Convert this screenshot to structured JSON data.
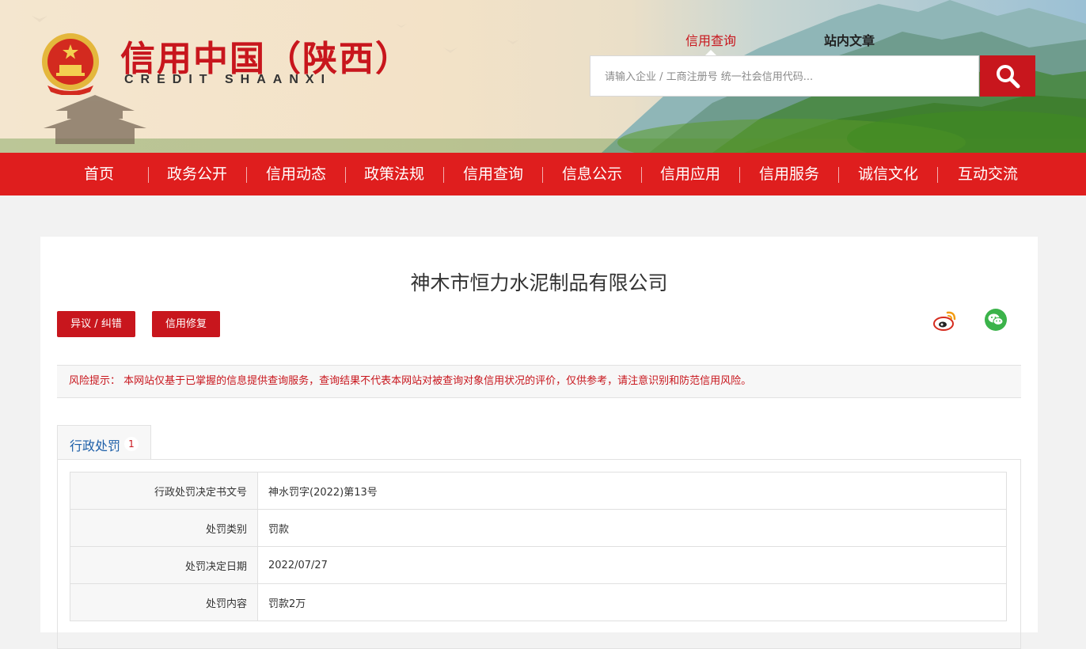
{
  "site": {
    "title": "信用中国（陕西）",
    "subtitle": "CREDIT  SHAANXI",
    "emblem_icon": "national-emblem-icon",
    "colors": {
      "brand_red": "#c8161d",
      "nav_red": "#df1e1e",
      "link_blue": "#1d5fa8"
    }
  },
  "search": {
    "tabs": [
      {
        "label": "信用查询",
        "active": true
      },
      {
        "label": "站内文章",
        "active": false
      }
    ],
    "placeholder": "请输入企业 / 工商注册号 统一社会信用代码...",
    "button_icon": "search-icon"
  },
  "nav": {
    "items": [
      "首页",
      "政务公开",
      "信用动态",
      "政策法规",
      "信用查询",
      "信息公示",
      "信用应用",
      "信用服务",
      "诚信文化",
      "互动交流"
    ]
  },
  "main": {
    "company_name": "神木市恒力水泥制品有限公司",
    "objection_button": "异议 / 纠错",
    "repair_button": "信用修复",
    "share_icons": [
      "weibo-icon",
      "wechat-icon"
    ],
    "risk_notice": "风险提示： 本网站仅基于已掌握的信息提供查询服务，查询结果不代表本网站对被查询对象信用状况的评价，仅供参考，请注意识别和防范信用风险。",
    "tab": {
      "label": "行政处罚",
      "count": "1"
    },
    "records": [
      {
        "key": "行政处罚决定书文号",
        "value": "神水罚字(2022)第13号"
      },
      {
        "key": "处罚类别",
        "value": "罚款"
      },
      {
        "key": "处罚决定日期",
        "value": "2022/07/27"
      },
      {
        "key": "处罚内容",
        "value": "罚款2万"
      }
    ]
  }
}
